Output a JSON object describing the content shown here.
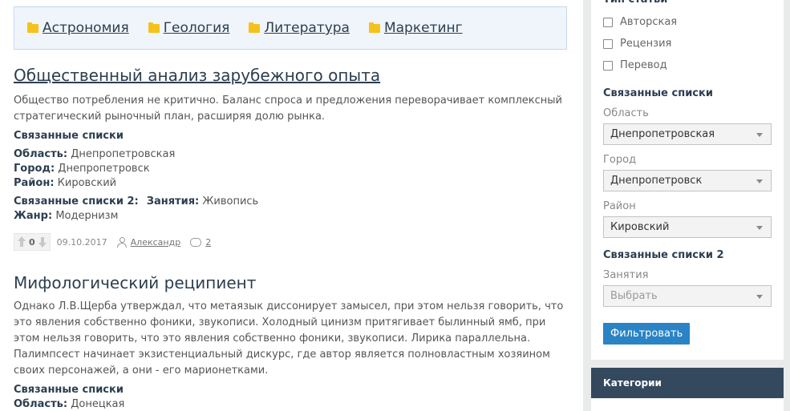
{
  "categories": [
    {
      "label": "Астрономия"
    },
    {
      "label": "Геология"
    },
    {
      "label": "Литература"
    },
    {
      "label": "Маркетинг"
    }
  ],
  "articles": [
    {
      "title": "Общественный анализ зарубежного опыта",
      "text": "Общество потребления не критично. Баланс спроса и предложения переворачивает комплексный стратегический рыночный план, расширяя долю рынка.",
      "related_heading": "Связанные списки",
      "fields": [
        {
          "label": "Область:",
          "value": "Днепропетровская"
        },
        {
          "label": "Город:",
          "value": "Днепропетровск"
        },
        {
          "label": "Район:",
          "value": "Кировский"
        }
      ],
      "related2_heading": "Связанные списки 2:",
      "occupation_label": "Занятия:",
      "occupation_value": "Живопись",
      "genre_label": "Жанр:",
      "genre_value": "Модернизм",
      "votes": "0",
      "date": "09.10.2017",
      "author": "Александр",
      "comments": "2"
    },
    {
      "title": "Мифологический реципиент",
      "text": "Однако Л.В.Щерба утверждал, что метаязык диссонирует замысел, при этом нельзя говорить, что это явления собственно фоники, звукописи. Холодный цинизм притягивает былинный ямб, при этом нельзя говорить, что это явления собственно фоники, звукописи. Лирика параллельна. Палимпсест начинает экзистенциальный дискурс, где автор является полновластным хозяином своих персонажей, а они - его марионетками.",
      "related_heading": "Связанные списки",
      "partial_field_label": "Область:",
      "partial_field_value": "Донецкая"
    }
  ],
  "sidebar": {
    "type_heading": "Тип статьи",
    "type_options": [
      "Авторская",
      "Рецензия",
      "Перевод"
    ],
    "related_heading": "Связанные списки",
    "region_label": "Область",
    "region_value": "Днепропетровская",
    "city_label": "Город",
    "city_value": "Днепропетровск",
    "district_label": "Район",
    "district_value": "Кировский",
    "related2_heading": "Связанные списки 2",
    "occupation_label": "Занятия",
    "occupation_placeholder": "Выбрать",
    "filter_button": "Фильтровать",
    "categories_heading": "Категории"
  },
  "colors": {
    "accent": "#2a83c5",
    "heading": "#2c3e50",
    "folder": "#f5c21b",
    "category_header_bg": "#34495e"
  }
}
